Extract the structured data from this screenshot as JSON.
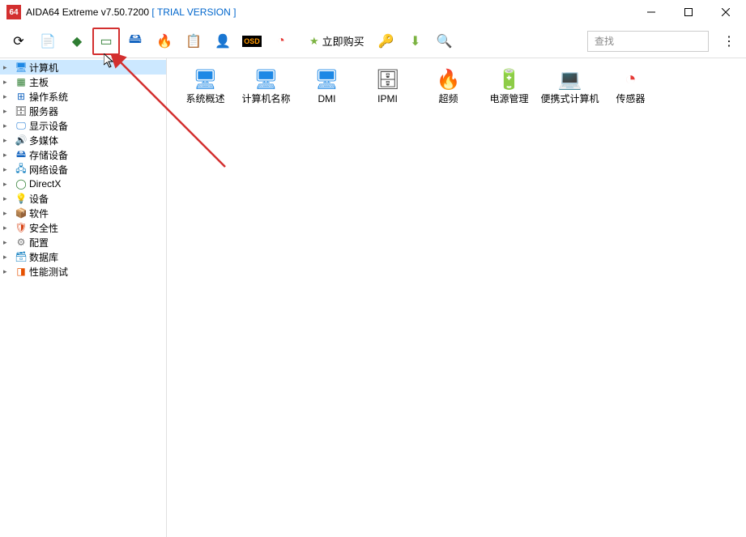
{
  "title": {
    "app_icon": "64",
    "text": "AIDA64 Extreme v7.50.7200  ",
    "trial": "[ TRIAL VERSION ]"
  },
  "toolbar": {
    "buy_label": "立即购买",
    "search_placeholder": "查找"
  },
  "sidebar": {
    "items": [
      {
        "label": "计算机",
        "selected": true
      },
      {
        "label": "主板"
      },
      {
        "label": "操作系统"
      },
      {
        "label": "服务器"
      },
      {
        "label": "显示设备"
      },
      {
        "label": "多媒体"
      },
      {
        "label": "存储设备"
      },
      {
        "label": "网络设备"
      },
      {
        "label": "DirectX"
      },
      {
        "label": "设备"
      },
      {
        "label": "软件"
      },
      {
        "label": "安全性"
      },
      {
        "label": "配置"
      },
      {
        "label": "数据库"
      },
      {
        "label": "性能测试"
      }
    ]
  },
  "content": {
    "items": [
      {
        "label": "系统概述"
      },
      {
        "label": "计算机名称"
      },
      {
        "label": "DMI"
      },
      {
        "label": "IPMI"
      },
      {
        "label": "超频"
      },
      {
        "label": "电源管理"
      },
      {
        "label": "便携式计算机"
      },
      {
        "label": "传感器"
      }
    ]
  }
}
